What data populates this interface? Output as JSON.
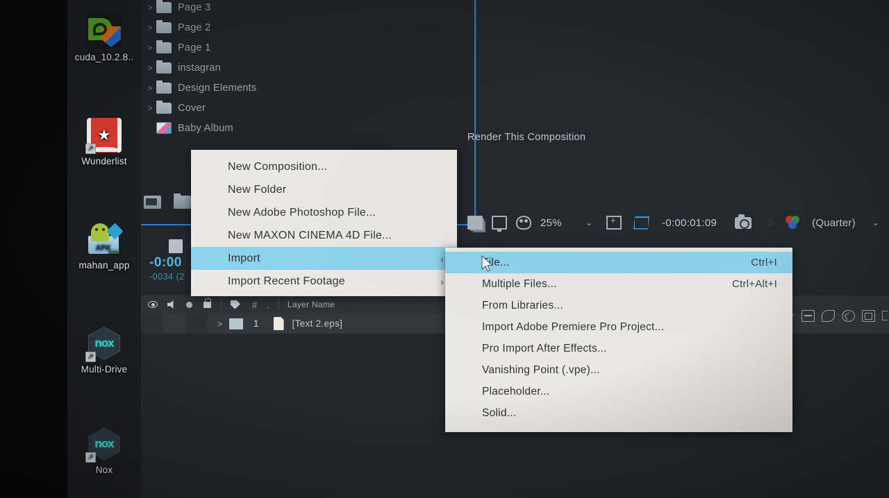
{
  "desktop": {
    "icons": [
      {
        "label": "cuda_10.2.8..",
        "icon": "nvidia-cuda-installer-icon"
      },
      {
        "label": "Wunderlist",
        "icon": "wunderlist-icon"
      },
      {
        "label": "mahan_app",
        "icon": "android-apk-nox-icon"
      },
      {
        "label": "Multi-Drive",
        "icon": "nox-multidrive-icon"
      },
      {
        "label": "Nox",
        "icon": "nox-player-icon"
      }
    ],
    "nox_wordmark": "nox"
  },
  "project_panel": {
    "tree": [
      {
        "label": "Page 3",
        "icon": "folder-icon",
        "twirl": ">"
      },
      {
        "label": "Page 2",
        "icon": "folder-icon",
        "twirl": ">"
      },
      {
        "label": "Page 1",
        "icon": "folder-icon",
        "twirl": ">"
      },
      {
        "label": "instagran",
        "icon": "folder-icon",
        "twirl": ">"
      },
      {
        "label": "Design Elements",
        "icon": "folder-icon",
        "twirl": ">"
      },
      {
        "label": "Cover",
        "icon": "folder-icon",
        "twirl": ">"
      },
      {
        "label": "Baby Album",
        "icon": "composition-icon",
        "twirl": ""
      }
    ],
    "tooltip": "Render This Composition",
    "footer_icons": [
      "new-composition-icon",
      "new-folder-icon"
    ]
  },
  "preview_bar": {
    "icons_left": [
      "take-snapshot-stack-icon",
      "monitor-icon",
      "face-mask-icon"
    ],
    "zoom_level": "25%",
    "zoom_chevron": "⌄",
    "region_of_interest": "roi-icon",
    "transparency_grid": "transparency-grid-icon",
    "timecode": "-0:00:01:09",
    "camera_icon": "snapshot-camera-icon",
    "show_snapshot": "show-snapshot-icon",
    "channels_icon": "color-channels-icon",
    "resolution": "(Quarter)",
    "resolution_chevron": "⌄"
  },
  "timeline": {
    "current_time": "-0:00",
    "frame_info": "-0034 (2",
    "header": {
      "eye": "video-visibility-icon",
      "audio": "audio-icon",
      "solo": "solo-icon",
      "lock": "lock-icon",
      "label_swatch": "label-tag-icon",
      "number": "#",
      "dot": ".",
      "layer_name": "Layer Name"
    },
    "rows": [
      {
        "index": "1",
        "name": "[Text 2.eps]",
        "twirl": ">",
        "icon": "eps-file-icon"
      }
    ]
  },
  "right_panel": {
    "icons": [
      "align-icon",
      "paint-icon",
      "roto-brush-icon",
      "cube-3d-icon"
    ]
  },
  "context_menu": {
    "items": [
      {
        "label": "New Composition...",
        "submenu": false,
        "selected": false
      },
      {
        "label": "New Folder",
        "submenu": false,
        "selected": false
      },
      {
        "label": "New Adobe Photoshop File...",
        "submenu": false,
        "selected": false
      },
      {
        "label": "New MAXON CINEMA 4D File...",
        "submenu": false,
        "selected": false
      },
      {
        "label": "Import",
        "submenu": true,
        "selected": true
      },
      {
        "label": "Import Recent Footage",
        "submenu": true,
        "selected": false
      }
    ],
    "submenu_arrow": "›"
  },
  "submenu": {
    "items": [
      {
        "label": "File...",
        "shortcut": "Ctrl+I",
        "selected": true
      },
      {
        "label": "Multiple Files...",
        "shortcut": "Ctrl+Alt+I",
        "selected": false
      },
      {
        "label": "From Libraries...",
        "shortcut": "",
        "selected": false
      },
      {
        "label": "Import Adobe Premiere Pro Project...",
        "shortcut": "",
        "selected": false
      },
      {
        "label": "Pro Import After Effects...",
        "shortcut": "",
        "selected": false
      },
      {
        "label": "Vanishing Point (.vpe)...",
        "shortcut": "",
        "selected": false
      },
      {
        "label": "Placeholder...",
        "shortcut": "",
        "selected": false
      },
      {
        "label": "Solid...",
        "shortcut": "",
        "selected": false
      }
    ]
  },
  "colors": {
    "menu_bg": "#eceae5",
    "menu_highlight": "#8ed4ef",
    "panel_focus_border": "#2a7fd4",
    "app_bg": "#22262b",
    "accent_blue": "#4fb8e0"
  }
}
